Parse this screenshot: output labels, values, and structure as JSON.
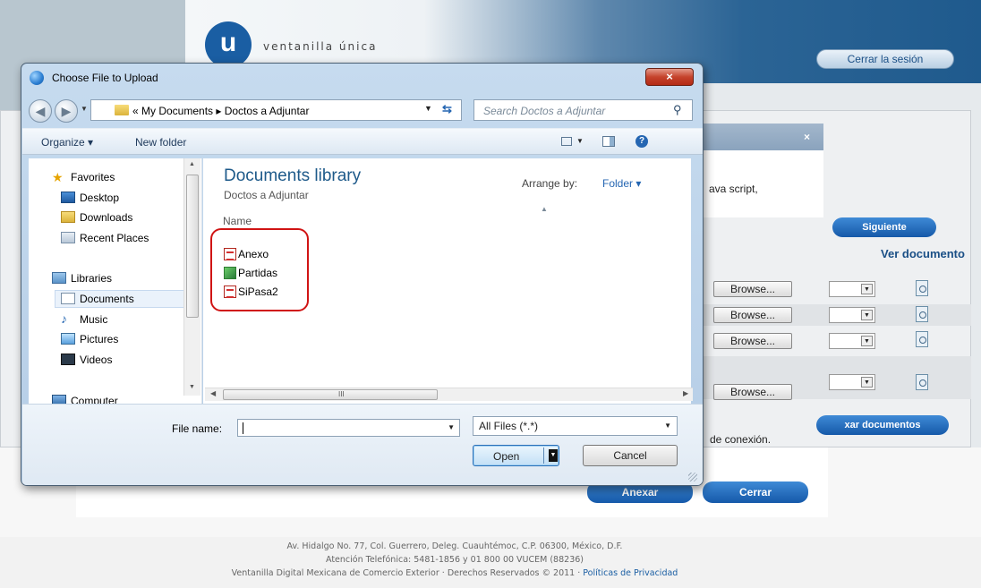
{
  "page": {
    "logo_letter": "u",
    "logo_text": "ventanilla única",
    "logout": "Cerrar la sesión",
    "js_text": "ava script,",
    "next_button": "Siguiente",
    "column_header": "Ver documento",
    "browse_label": "Browse...",
    "attach_docs_button": "xar documentos",
    "connection_text": "de conexión.",
    "attach_button": "Anexar",
    "close_button": "Cerrar",
    "modal_close": "×",
    "footer": {
      "line1": "Av. Hidalgo No. 77, Col. Guerrero, Deleg. Cuauhtémoc, C.P. 06300, México, D.F.",
      "line2": "Atención Telefónica: 5481-1856 y 01 800 00 VUCEM (88236)",
      "line3": "Ventanilla Digital Mexicana de Comercio Exterior · Derechos Reservados © 2011 · ",
      "privacy": "Políticas de Privacidad"
    }
  },
  "dialog": {
    "title": "Choose File to Upload",
    "close": "×",
    "address": "« My Documents ▸ Doctos a Adjuntar",
    "search_placeholder": "Search Doctos a Adjuntar",
    "organize": "Organize ▾",
    "new_folder": "New folder",
    "nav": {
      "favorites": "Favorites",
      "desktop": "Desktop",
      "downloads": "Downloads",
      "recent": "Recent Places",
      "libraries": "Libraries",
      "documents": "Documents",
      "music": "Music",
      "pictures": "Pictures",
      "videos": "Videos",
      "computer": "Computer"
    },
    "library_title": "Documents library",
    "library_subtitle": "Doctos a Adjuntar",
    "arrange_label": "Arrange by:",
    "arrange_value": "Folder ▾",
    "column_name": "Name",
    "files": [
      {
        "name": "Anexo",
        "type": "pdf"
      },
      {
        "name": "Partidas",
        "type": "xls"
      },
      {
        "name": "SiPasa2",
        "type": "pdf"
      }
    ],
    "file_name_label": "File name:",
    "file_name_value": "",
    "filter": "All Files (*.*)",
    "open": "Open",
    "cancel": "Cancel"
  },
  "colors": {
    "accent": "#1a5ea3",
    "highlight": "#d01414"
  }
}
